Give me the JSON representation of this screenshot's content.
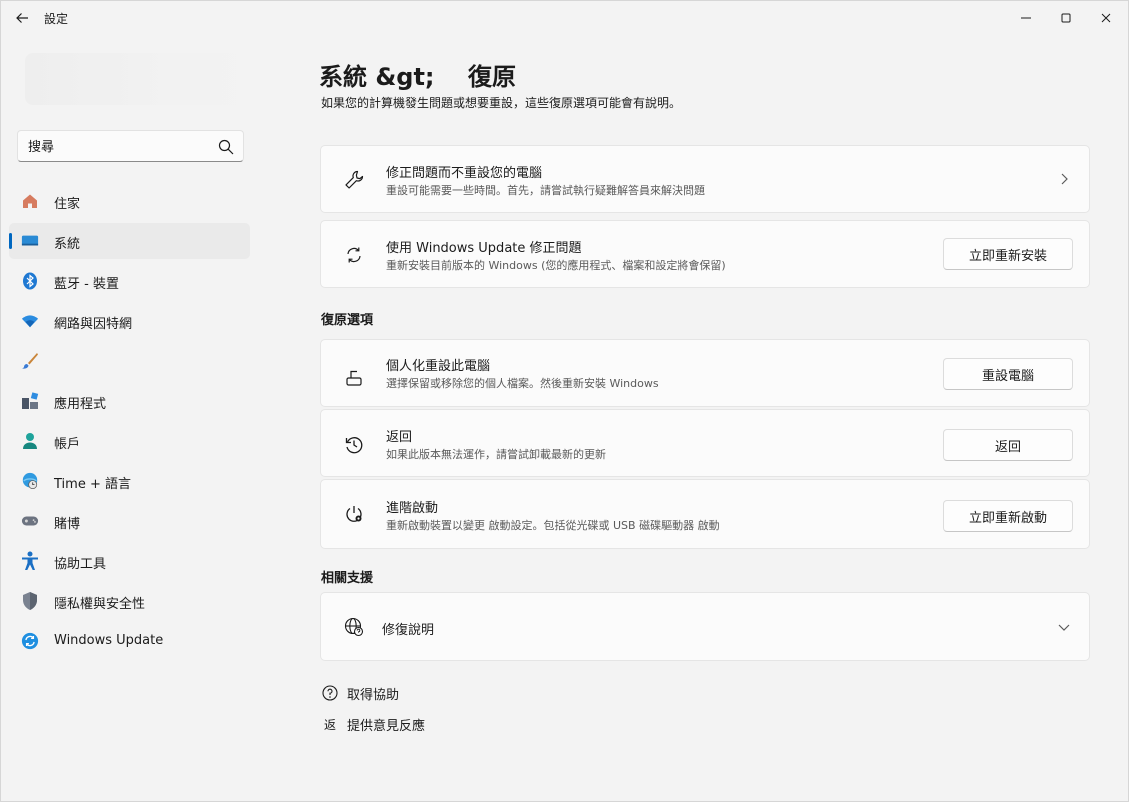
{
  "window": {
    "title": "設定"
  },
  "sidebar": {
    "search": {
      "placeholder": "搜尋"
    },
    "items": [
      {
        "label": "住家",
        "icon": "home-icon"
      },
      {
        "label": "系統",
        "icon": "system-icon",
        "selected": true
      },
      {
        "label": "藍牙 - 裝置",
        "icon": "bluetooth-icon"
      },
      {
        "label": "網路與因特網",
        "icon": "wifi-icon"
      },
      {
        "label": "",
        "icon": "personalization-brush-icon"
      },
      {
        "label": "應用程式",
        "icon": "apps-icon"
      },
      {
        "label": "帳戶",
        "icon": "account-icon"
      },
      {
        "label": "Time + 語言",
        "icon": "time-language-icon"
      },
      {
        "label": "賭博",
        "icon": "gaming-icon"
      },
      {
        "label": "協助工具",
        "icon": "accessibility-icon"
      },
      {
        "label": "隱私權與安全性",
        "icon": "privacy-shield-icon"
      },
      {
        "label": "Windows Update",
        "icon": "windows-update-icon"
      }
    ]
  },
  "main": {
    "title": "系統 &gt;    復原",
    "subtitle": "如果您的計算機發生問題或想要重設，這些復原選項可能會有說明。",
    "cards_top": [
      {
        "title": "修正問題而不重設您的電腦",
        "desc": "重設可能需要一些時間。首先，請嘗試執行疑難解答員來解決問題",
        "icon": "wrench-icon"
      },
      {
        "title": "使用 Windows Update 修正問題",
        "desc": "重新安裝目前版本的 Windows (您的應用程式、檔案和設定將會保留)",
        "button": "立即重新安裝",
        "icon": "sync-icon"
      }
    ],
    "recovery_section": {
      "title": "復原選項",
      "cards": [
        {
          "title": "個人化重設此電腦",
          "desc": "選擇保留或移除您的個人檔案。然後重新安裝 Windows",
          "button": "重設電腦",
          "icon": "reset-pc-icon"
        },
        {
          "title": "返回",
          "desc": "如果此版本無法運作，請嘗試卸載最新的更新",
          "button": "返回",
          "icon": "history-icon"
        },
        {
          "title": "進階啟動",
          "desc": "重新啟動裝置以變更 啟動設定。包括從光碟或 USB 磁碟驅動器 啟動",
          "button": "立即重新啟動",
          "icon": "advanced-startup-icon"
        }
      ]
    },
    "related_section": {
      "title": "相關支援",
      "help_card": {
        "title": "修復說明",
        "icon": "globe-help-icon"
      }
    },
    "links": [
      {
        "label": "取得協助",
        "icon": "help-icon"
      },
      {
        "label": "提供意見反應",
        "icon_text": "返"
      }
    ]
  }
}
